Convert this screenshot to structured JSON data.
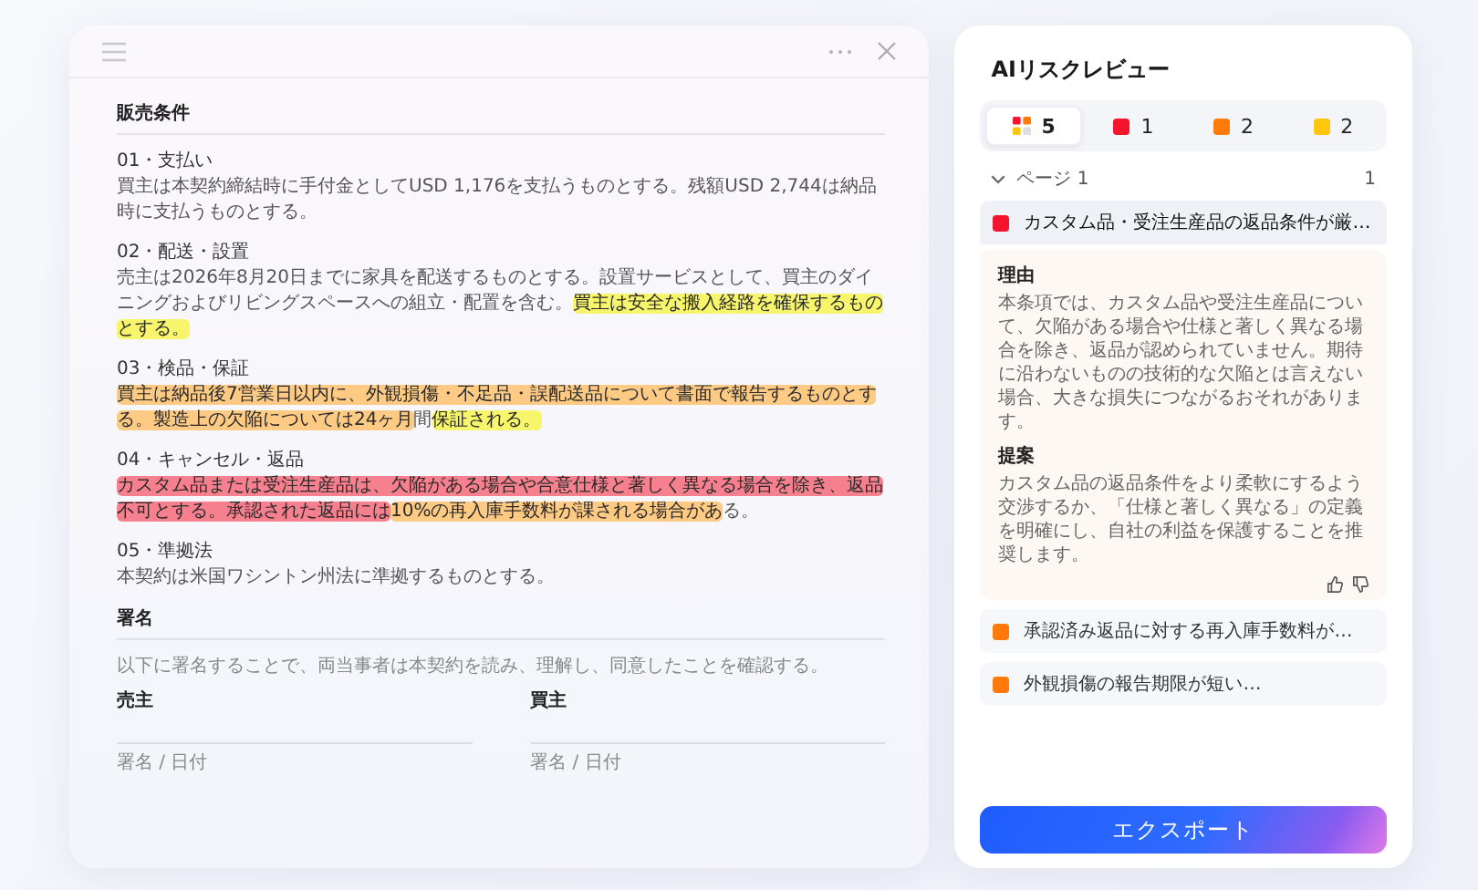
{
  "document": {
    "heading": "販売条件",
    "clauses": [
      {
        "label": "01・支払い",
        "segments": [
          {
            "text": "買主は本契約締結時に手付金としてUSD 1,176を支払うものとする。残額USD 2,744は納品時に支払うものとする。"
          }
        ]
      },
      {
        "label": "02・配送・設置",
        "segments": [
          {
            "text": "売主は2026年8月20日までに家具を配送するものとする。設置サービスとして、買主のダイニングおよびリビングスペースへの組立・配置を含む。"
          },
          {
            "text": "買主は安全な搬入経路を確保するものとする。",
            "color": "#f6f56c"
          }
        ]
      },
      {
        "label": "03・検品・保証",
        "segments": [
          {
            "text": "買主は納品後7営業日以内に、外観損傷・不足品・誤配送品について書面で報告するものとする。製造上の欠陥については24ヶ月",
            "color": "#ffcb84"
          },
          {
            "text": "間"
          },
          {
            "text": "保証される。",
            "color": "#f6f56c"
          }
        ]
      },
      {
        "label": "04・キャンセル・返品",
        "segments": [
          {
            "text": "カスタム品または受注生産品は、欠陥がある場合や合意仕様と著しく異なる場合を除き、返品不可とする。承認された返品には",
            "color": "#f7808f"
          },
          {
            "text": "10%の再入庫手数料が課される場合があ",
            "color": "#ffcb84"
          },
          {
            "text": "る。"
          }
        ]
      },
      {
        "label": "05・準拠法",
        "segments": [
          {
            "text": "本契約は米国ワシントン州法に準拠するものとする。"
          }
        ]
      }
    ],
    "signature": {
      "heading": "署名",
      "note": "以下に署名することで、両当事者は本契約を読み、理解し、同意したことを確認する。",
      "parties": [
        {
          "name": "売主",
          "line_label": "署名 / 日付"
        },
        {
          "name": "買主",
          "line_label": "署名 / 日付"
        }
      ]
    }
  },
  "review": {
    "title": "AIリスクレビュー",
    "filters": [
      {
        "kind": "all",
        "count": "5",
        "selected": true
      },
      {
        "kind": "level",
        "color": "#f5142b",
        "count": "1",
        "selected": false
      },
      {
        "kind": "level",
        "color": "#ff7a0a",
        "count": "2",
        "selected": false
      },
      {
        "kind": "level",
        "color": "#ffc60a",
        "count": "2",
        "selected": false
      }
    ],
    "page": {
      "label": "ページ 1",
      "count": "1",
      "expanded": true
    },
    "issues": [
      {
        "color": "#f5142b",
        "text": "カスタム品・受注生産品の返品条件が厳…",
        "expanded": true,
        "reason_title": "理由",
        "reason": "本条項では、カスタム品や受注生産品について、欠陥がある場合や仕様と著しく異なる場合を除き、返品が認められていません。期待に沿わないものの技術的な欠陥とは言えない場合、大きな損失につながるおそれがあります。",
        "proposal_title": "提案",
        "proposal": "カスタム品の返品条件をより柔軟にするよう交渉するか、「仕様と著しく異なる」の定義を明確にし、自社の利益を保護することを推奨します。"
      },
      {
        "color": "#ff7a0a",
        "text": "承認済み返品に対する再入庫手数料が…",
        "expanded": false
      },
      {
        "color": "#ff7a0a",
        "text": "外観損傷の報告期限が短い…",
        "expanded": false
      }
    ],
    "export_button": "エクスポート"
  }
}
